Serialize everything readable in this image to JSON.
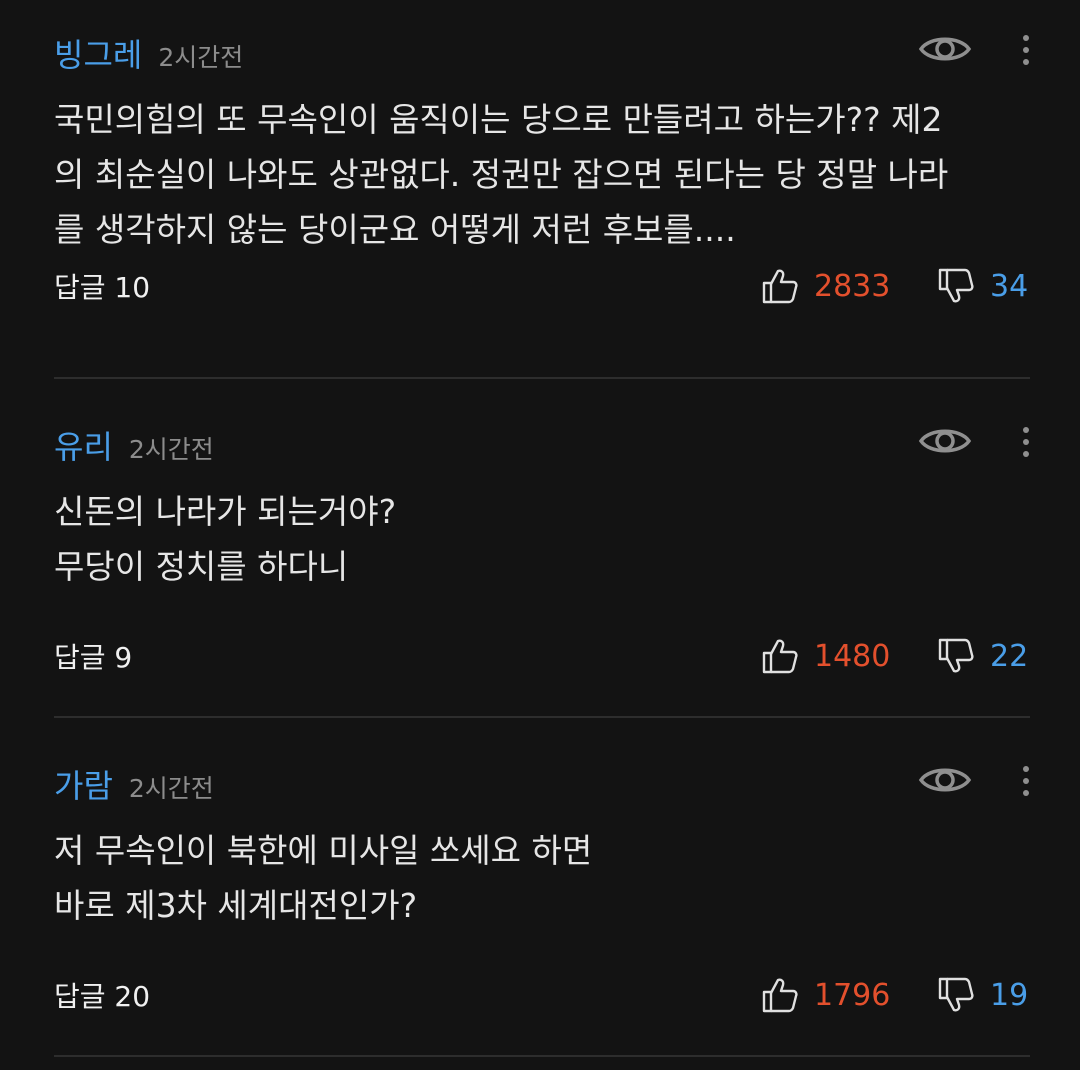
{
  "comments": [
    {
      "author": "빙그레",
      "time": "2시간전",
      "lines": [
        "국민의힘의 또 무속인이 움직이는 당으로 만들려고 하는가?? 제2",
        "의 최순실이 나와도 상관없다. 정권만 잡으면 된다는 당 정말 나라",
        "를 생각하지 않는 당이군요 어떻게 저런 후보를...."
      ],
      "reply_label": "답글 10",
      "likes": "2833",
      "dislikes": "34"
    },
    {
      "author": "유리",
      "time": "2시간전",
      "lines": [
        "신돈의 나라가 되는거야?",
        "무당이 정치를 하다니"
      ],
      "reply_label": "답글 9",
      "likes": "1480",
      "dislikes": "22"
    },
    {
      "author": "가람",
      "time": "2시간전",
      "lines": [
        "저 무속인이 북한에 미사일 쏘세요 하면",
        "바로 제3차 세계대전인가?"
      ],
      "reply_label": "답글 20",
      "likes": "1796",
      "dislikes": "19"
    }
  ],
  "colors": {
    "background": "#131313",
    "author": "#4a9ee8",
    "like": "#e3502d",
    "dislike": "#4a9ee8",
    "divider": "#2d2d2d"
  },
  "icons": {
    "view": "eye-icon",
    "more": "more-vertical-icon",
    "like": "thumbs-up-icon",
    "dislike": "thumbs-down-icon"
  }
}
